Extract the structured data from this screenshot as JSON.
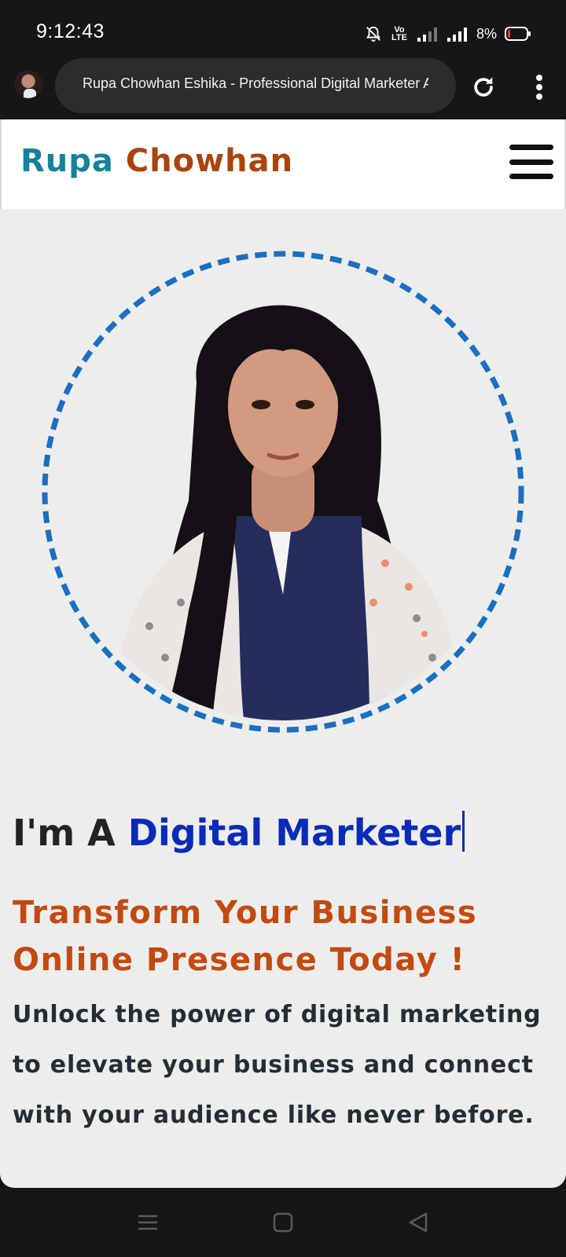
{
  "status_bar": {
    "time": "9:12:43",
    "battery_percent": "8%",
    "network_label": "Vo LTE",
    "icons": [
      "bell-off-icon",
      "volte-icon",
      "signal-weak-icon",
      "signal-icon",
      "battery-low-icon"
    ]
  },
  "browser": {
    "tab_title": "Rupa Chowhan Eshika - Professional Digital Marketer Ar",
    "icons": [
      "site-favicon",
      "reload-icon",
      "more-vert-icon"
    ]
  },
  "site": {
    "brand_first": "Rupa",
    "brand_last": "Chowhan",
    "colors": {
      "brand_first": "#17809b",
      "brand_last": "#a8440c",
      "ring": "#1a6fc0",
      "role": "#0a2bb8",
      "tagline": "#c24a10"
    }
  },
  "hero": {
    "headline_prefix": "I'm A",
    "headline_role": "Digital Marketer",
    "tagline_line1": "Transform Your Business",
    "tagline_line2": "Online Presence Today !",
    "description_line1": "Unlock the power of digital marketing",
    "description_line2": "to elevate your business and connect",
    "description_line3": "with your audience like never before."
  },
  "nav_bar": {
    "icons": [
      "menu-icon",
      "home-square-icon",
      "back-triangle-icon"
    ]
  }
}
